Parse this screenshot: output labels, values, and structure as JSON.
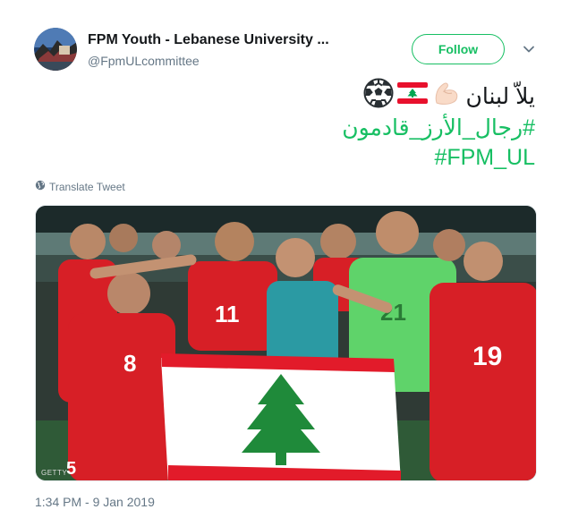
{
  "user": {
    "display_name": "FPM Youth - Lebanese University ...",
    "handle": "@FpmULcommittee"
  },
  "follow_button": {
    "label": "Follow"
  },
  "tweet": {
    "line1_text": "يلاّ لبنان",
    "line1_emojis": [
      "flexed-biceps-icon",
      "lebanon-flag-icon",
      "soccer-ball-icon"
    ],
    "hashtags": [
      "#رجال_الأرز_قادمون",
      "#FPM_UL"
    ]
  },
  "translate_link": {
    "label": "Translate Tweet"
  },
  "media": {
    "description_icon": "team-photo",
    "credit": "GETTY"
  },
  "timestamp": "1:34 PM - 9 Jan 2019",
  "colors": {
    "accent_green": "#17bf63",
    "text_primary": "#14171a",
    "text_secondary": "#657786",
    "jersey_red": "#d71f26"
  }
}
